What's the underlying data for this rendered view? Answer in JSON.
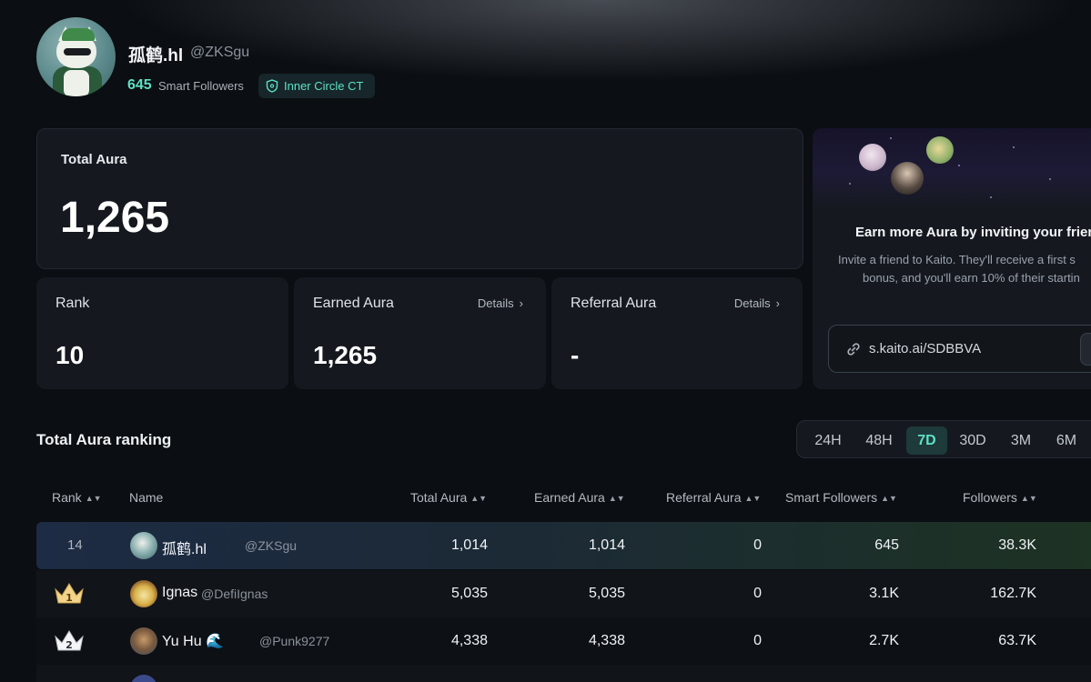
{
  "profile": {
    "name": "孤鹤.hl",
    "handle": "@ZKSgu",
    "smart_followers_count": "645",
    "smart_followers_label": "Smart Followers",
    "badge": "Inner Circle CT"
  },
  "total_aura": {
    "label": "Total Aura",
    "value": "1,265"
  },
  "stats": {
    "rank": {
      "label": "Rank",
      "value": "10"
    },
    "earned": {
      "label": "Earned Aura",
      "value": "1,265",
      "details": "Details"
    },
    "referral": {
      "label": "Referral Aura",
      "value": "-",
      "details": "Details"
    }
  },
  "invite": {
    "title": "Earn more Aura by inviting your friends",
    "desc_line1": "Invite a friend to Kaito. They'll receive a first s",
    "desc_line2": "bonus, and you'll earn 10% of their startin",
    "link": "s.kaito.ai/SDBBVA"
  },
  "ranking": {
    "title": "Total Aura ranking",
    "ranges": [
      "24H",
      "48H",
      "7D",
      "30D",
      "3M",
      "6M"
    ],
    "active_range": "7D",
    "columns": [
      "Rank",
      "Name",
      "Total Aura",
      "Earned Aura",
      "Referral Aura",
      "Smart Followers",
      "Followers"
    ],
    "rows": [
      {
        "rank": "14",
        "name": "孤鹤.hl",
        "handle": "@ZKSgu",
        "total": "1,014",
        "earned": "1,014",
        "referral": "0",
        "smart": "645",
        "followers": "38.3K"
      },
      {
        "rank": "1",
        "name": "Ignas",
        "handle": "@DefiIgnas",
        "total": "5,035",
        "earned": "5,035",
        "referral": "0",
        "smart": "3.1K",
        "followers": "162.7K"
      },
      {
        "rank": "2",
        "name": "Yu Hu 🌊",
        "handle": "@Punk9277",
        "total": "4,338",
        "earned": "4,338",
        "referral": "0",
        "smart": "2.7K",
        "followers": "63.7K"
      }
    ]
  },
  "colors": {
    "accent": "#5fe0c5",
    "background": "#0b0e12",
    "card": "#15191f"
  }
}
